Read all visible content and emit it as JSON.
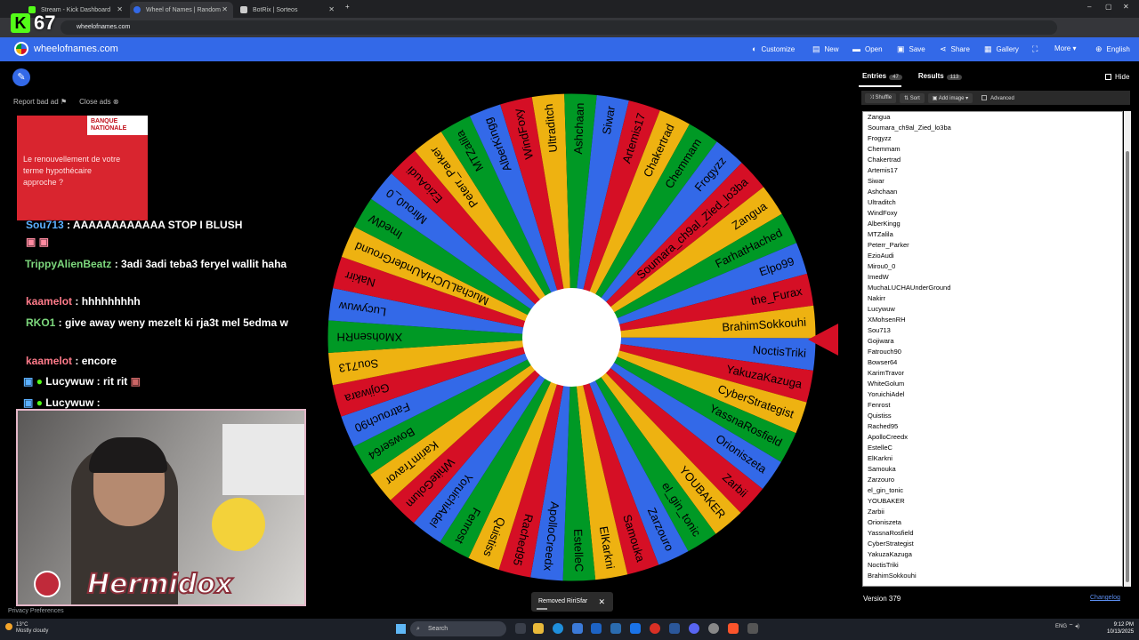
{
  "browser": {
    "tabs": [
      {
        "label": "Stream - Kick Dashboard",
        "color": "#53fc18"
      },
      {
        "label": "Wheel of Names | Random",
        "color": "#3369e8"
      },
      {
        "label": "BotRix | Sorteos",
        "color": "#cccccc"
      }
    ],
    "url": "wheelofnames.com"
  },
  "overlay": {
    "kick_letter": "K",
    "viewer_count": "67"
  },
  "nav": {
    "brand": "wheelofnames.com",
    "items": [
      {
        "icon": "palette-icon",
        "glyph": "◐",
        "label": "Customize"
      },
      {
        "icon": "file-icon",
        "glyph": "▤",
        "label": "New"
      },
      {
        "icon": "folder-icon",
        "glyph": "▬",
        "label": "Open"
      },
      {
        "icon": "save-icon",
        "glyph": "▣",
        "label": "Save"
      },
      {
        "icon": "share-icon",
        "glyph": "⋖",
        "label": "Share"
      },
      {
        "icon": "gallery-icon",
        "glyph": "▦",
        "label": "Gallery"
      },
      {
        "icon": "fullscreen-icon",
        "glyph": "⛶",
        "label": ""
      },
      {
        "icon": "more-icon",
        "glyph": "",
        "label": "More ▾"
      },
      {
        "icon": "globe-icon",
        "glyph": "⊕",
        "label": "English"
      }
    ]
  },
  "ad": {
    "report": "Report bad ad",
    "close": "Close ads",
    "brand": "BANQUE NATIONALE",
    "text": "Le renouvellement de votre terme hypothécaire approche ?"
  },
  "chat": [
    {
      "user": "Sou713",
      "color": "#5bb0ff",
      "text": " : AAAAAAAAAAAA STOP I BLUSH"
    },
    {
      "user": "TrippyAlienBeatz",
      "color": "#7dd87d",
      "text": " : 3adi 3adi teba3 feryel wallit haha"
    },
    {
      "user": "kaamelot",
      "color": "#ff7b8a",
      "text": " : hhhhhhhhh"
    },
    {
      "user": "RKO1",
      "color": "#7dd87d",
      "text": " : give away weny mezelt ki rja3t mel 5edma w"
    },
    {
      "user": "kaamelot",
      "color": "#ff7b8a",
      "text": " : encore"
    },
    {
      "user": "Lucywuw",
      "color": "#ffffff",
      "text": " : rit rit"
    },
    {
      "user": "Lucywuw",
      "color": "#ffffff",
      "text": " :"
    }
  ],
  "webcam": {
    "streamer_name": "Hermidox"
  },
  "privacy": "Privacy Preferences",
  "wheel": {
    "colors": [
      "#3369e8",
      "#d50f25",
      "#eeb211",
      "#009925"
    ],
    "segments": [
      "NoctisTriki",
      "YakuzaKazuga",
      "CyberStrategist",
      "YassnaRosfield",
      "Orioniszeta",
      "Zarbii",
      "YOUBAKER",
      "el_gin_tonic",
      "Zarzouro",
      "Samouka",
      "ElKarkni",
      "EstelleC",
      "ApolloCreedx",
      "Rached95",
      "Quistiss",
      "Fenrost",
      "YoruichiAdel",
      "WhiteGolum",
      "KarimTravor",
      "Bowser64",
      "Fatrouch90",
      "Gojiwara",
      "Sou713",
      "XMohsenRH",
      "Lucywuw",
      "Nakirr",
      "MuchaLUCHAUnderGround",
      "ImedW",
      "Mirou0_0",
      "EzioAudi",
      "Peterr_Parker",
      "MTZalila",
      "AlberKingg",
      "WindFoxy",
      "Ultraditch",
      "Ashchaan",
      "Siwar",
      "Artemis17",
      "Chakertrad",
      "Chemmam",
      "Frogyzz",
      "Soumara_ch9al_Zied_lo3ba",
      "Zangua",
      "FarhatHached",
      "Elpo99",
      "the_Furax",
      "BrahimSokkouhi"
    ]
  },
  "toast": {
    "text": "Removed RiriSfar"
  },
  "panel": {
    "tab_entries": "Entries",
    "entries_count": "47",
    "tab_results": "Results",
    "results_count": "113",
    "hide": "Hide",
    "tools": {
      "shuffle": "Shuffle",
      "sort": "Sort",
      "add_image": "Add image ▾",
      "advanced": "Advanced"
    },
    "entries": [
      "Zangua",
      "Soumara_ch9al_Zied_lo3ba",
      "Frogyzz",
      "Chemmam",
      "Chakertrad",
      "Artemis17",
      "Siwar",
      "Ashchaan",
      "Ultraditch",
      "WindFoxy",
      "AlberKingg",
      "MTZalila",
      "Peterr_Parker",
      "EzioAudi",
      "Mirou0_0",
      "ImedW",
      "MuchaLUCHAUnderGround",
      "Nakirr",
      "Lucywuw",
      "XMohsenRH",
      "Sou713",
      "Gojiwara",
      "Fatrouch90",
      "Bowser64",
      "KarimTravor",
      "WhiteGolum",
      "YoruichiAdel",
      "Fenrost",
      "Quistiss",
      "Rached95",
      "ApolloCreedx",
      "EstelleC",
      "ElKarkni",
      "Samouka",
      "Zarzouro",
      "el_gin_tonic",
      "YOUBAKER",
      "Zarbii",
      "Orioniszeta",
      "YassnaRosfield",
      "CyberStrategist",
      "YakuzaKazuga",
      "NoctisTriki",
      "BrahimSokkouhi"
    ],
    "version": "Version 379",
    "changelog": "Changelog"
  },
  "taskbar": {
    "temp": "13°C",
    "weather": "Mostly cloudy",
    "search": "Search",
    "lang": "ENG",
    "time": "9:12 PM",
    "date": "10/13/2025"
  }
}
